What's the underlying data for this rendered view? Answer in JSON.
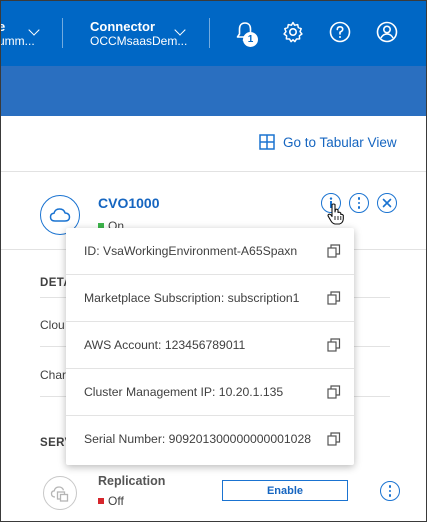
{
  "header": {
    "account": {
      "title": "e",
      "subtitle": "umm..."
    },
    "connector": {
      "title": "Connector",
      "subtitle": "OCCMsaasDem..."
    },
    "notification_count": "1"
  },
  "toolbar": {
    "tabular_view_label": "Go to Tabular View"
  },
  "working_environment": {
    "name": "CVO1000",
    "status": "On",
    "status_color": "#3cb44b"
  },
  "underlying": {
    "details_label": "DETA",
    "cloud_label": "Clou",
    "charging_label": "Char",
    "services_label": "SERV"
  },
  "info_popover": {
    "rows": [
      {
        "text": "ID: VsaWorkingEnvironment-A65Spaxn"
      },
      {
        "text": "Marketplace Subscription: subscription1"
      },
      {
        "text": "AWS Account: 123456789011"
      },
      {
        "text": "Cluster Management IP: 10.20.1.135"
      },
      {
        "text": "Serial Number: 909201300000000001028"
      }
    ]
  },
  "services": {
    "replication": {
      "name": "Replication",
      "status": "Off",
      "status_color": "#d6262c",
      "button_label": "Enable"
    }
  },
  "colors": {
    "brand": "#0067c5",
    "accent": "#1a73d1",
    "link": "#1565c0"
  }
}
